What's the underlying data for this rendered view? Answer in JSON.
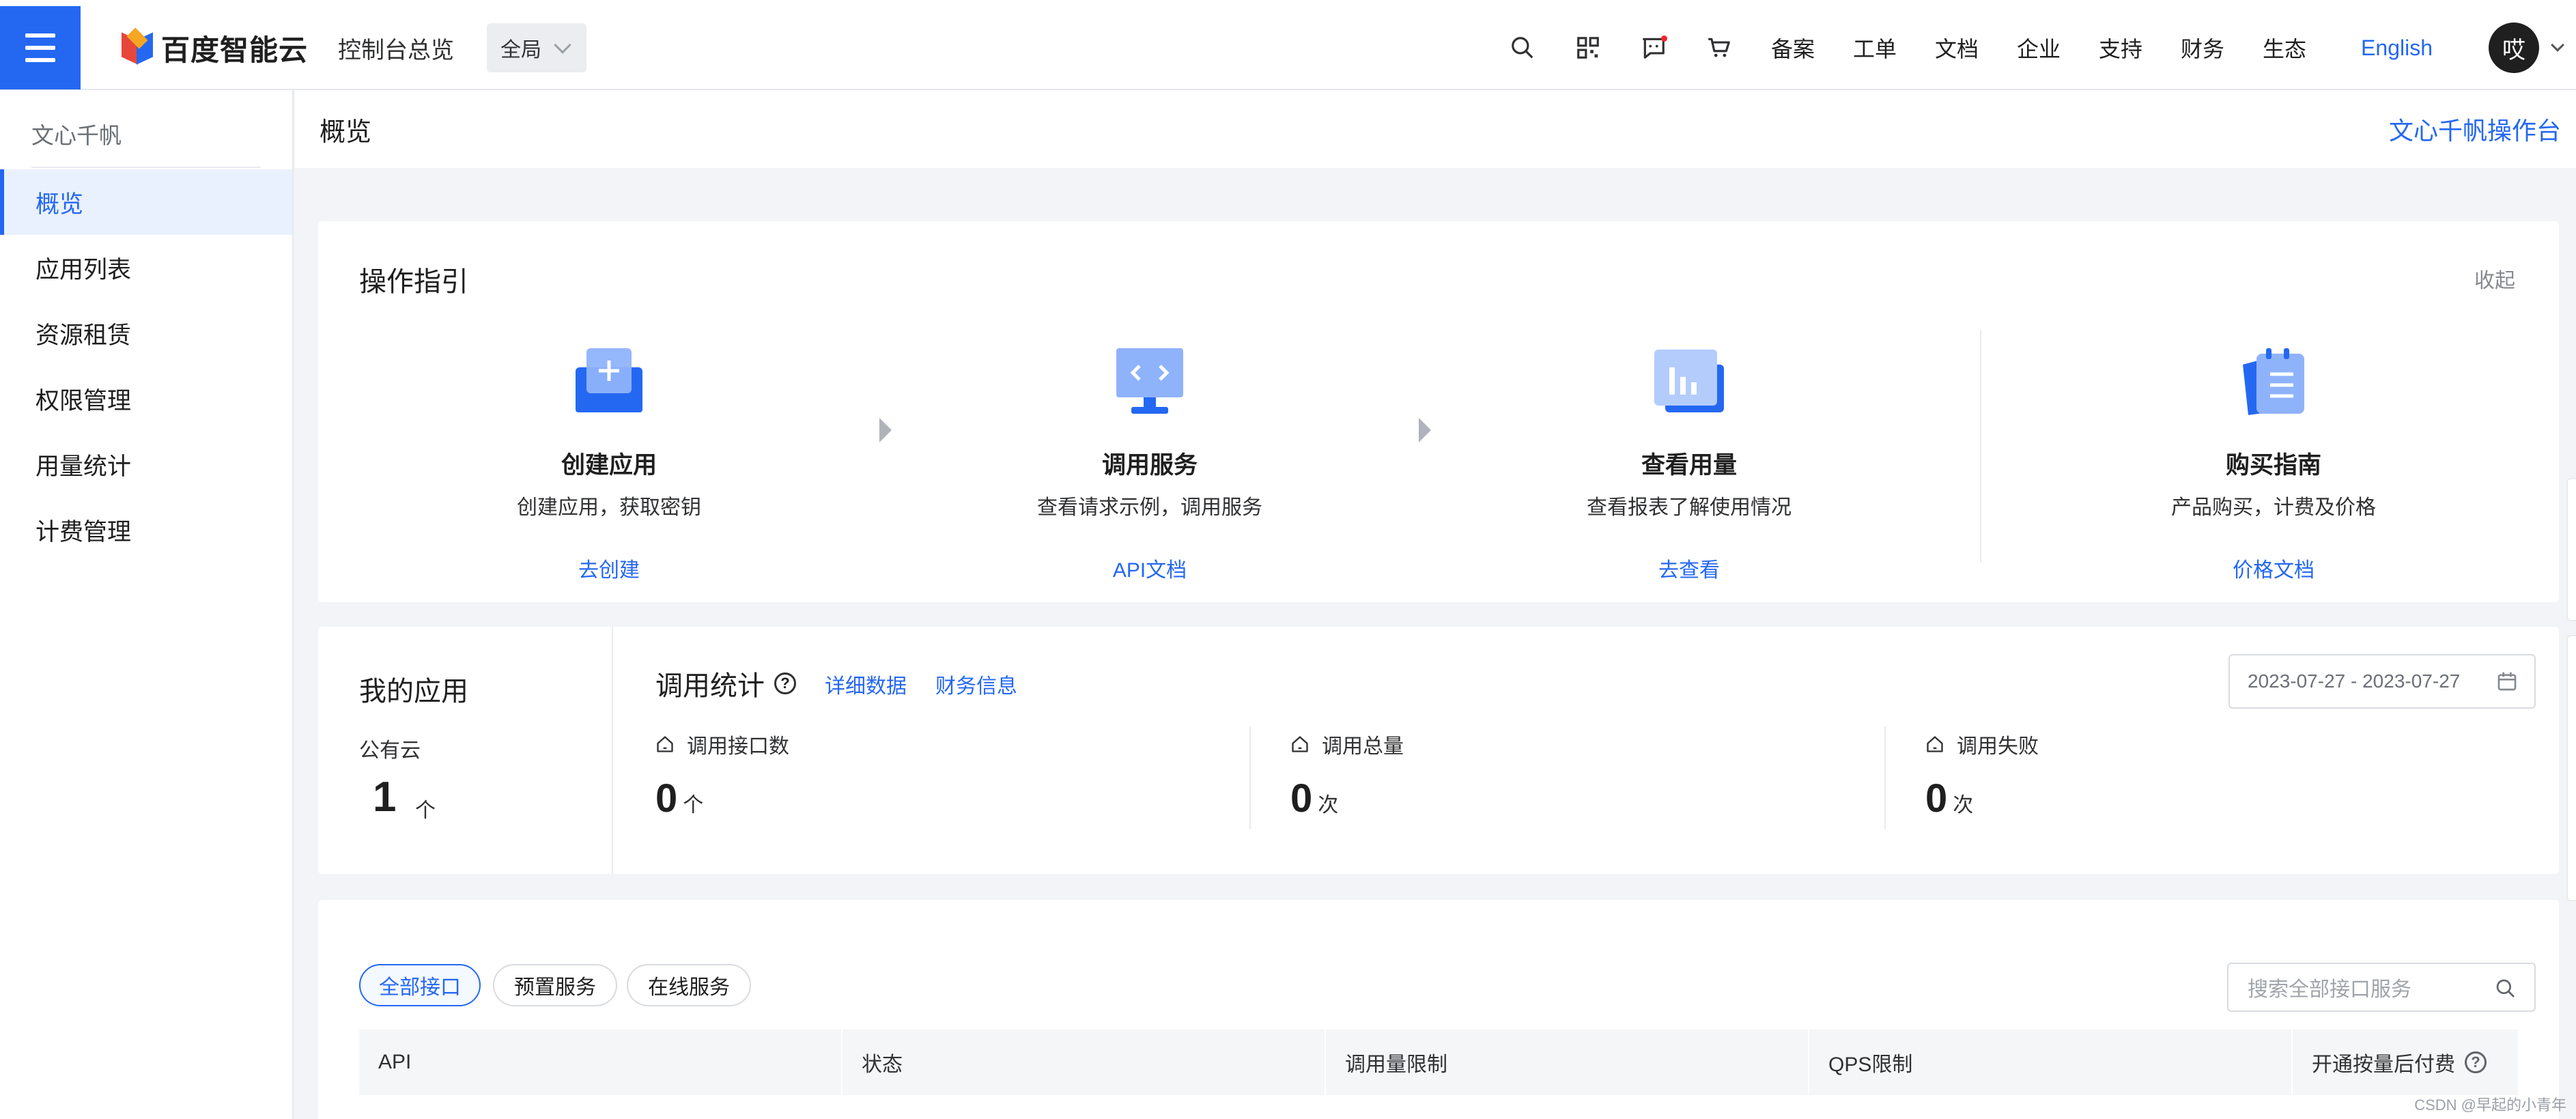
{
  "topbar": {
    "logo_text": "百度智能云",
    "console_label": "控制台总览",
    "scope_value": "全局",
    "icons": [
      "search-icon",
      "qrcode-icon",
      "message-icon",
      "cart-icon"
    ],
    "links": [
      "备案",
      "工单",
      "文档",
      "企业",
      "支持",
      "财务",
      "生态"
    ],
    "english_label": "English",
    "avatar_char": "哎"
  },
  "sidebar": {
    "title": "文心千帆",
    "items": [
      {
        "label": "概览",
        "active": true
      },
      {
        "label": "应用列表"
      },
      {
        "label": "资源租赁"
      },
      {
        "label": "权限管理"
      },
      {
        "label": "用量统计"
      },
      {
        "label": "计费管理"
      }
    ]
  },
  "page": {
    "title": "概览",
    "action": "文心千帆操作台"
  },
  "guide": {
    "title": "操作指引",
    "collapse": "收起",
    "steps": [
      {
        "name": "创建应用",
        "desc": "创建应用，获取密钥",
        "link": "去创建",
        "icon": "create-app-icon"
      },
      {
        "name": "调用服务",
        "desc": "查看请求示例，调用服务",
        "link": "API文档",
        "icon": "call-service-icon"
      },
      {
        "name": "查看用量",
        "desc": "查看报表了解使用情况",
        "link": "去查看",
        "icon": "usage-chart-icon"
      },
      {
        "name": "购买指南",
        "desc": "产品购买，计费及价格",
        "link": "价格文档",
        "icon": "purchase-guide-icon"
      }
    ]
  },
  "my_apps": {
    "title": "我的应用",
    "subtitle": "公有云",
    "count": "1",
    "unit": "个"
  },
  "call_stats": {
    "title": "调用统计",
    "links": [
      "详细数据",
      "财务信息"
    ],
    "date_range": "2023-07-27 - 2023-07-27",
    "metrics": [
      {
        "label": "调用接口数",
        "value": "0",
        "unit": "个"
      },
      {
        "label": "调用总量",
        "value": "0",
        "unit": "次"
      },
      {
        "label": "调用失败",
        "value": "0",
        "unit": "次"
      }
    ]
  },
  "apis": {
    "filters": [
      "全部接口",
      "预置服务",
      "在线服务"
    ],
    "search_placeholder": "搜索全部接口服务",
    "columns": [
      "API",
      "状态",
      "调用量限制",
      "QPS限制",
      "开通按量后付费"
    ]
  },
  "watermark": "CSDN @早起的小青年",
  "colors": {
    "accent": "#2468f2",
    "bg": "#f2f4f7",
    "badge": "#f5222d"
  }
}
